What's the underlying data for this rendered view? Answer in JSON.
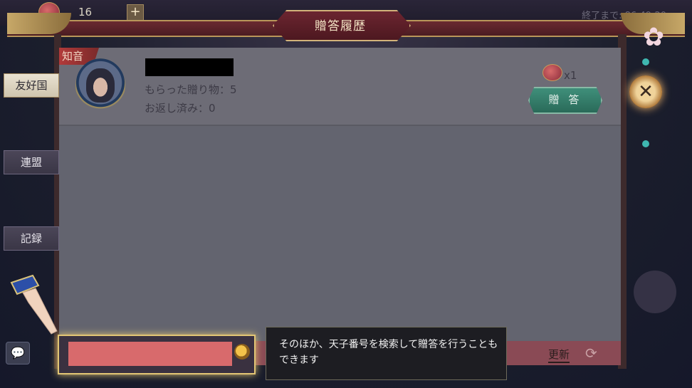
{
  "header": {
    "currency_value": "16",
    "plus_label": "+",
    "timer": "終了まで: 86:49:20",
    "title": "贈答履歴"
  },
  "tabs": [
    {
      "label": "友好国",
      "active": true
    },
    {
      "label": "連盟",
      "active": false
    },
    {
      "label": "記録",
      "active": false
    }
  ],
  "card": {
    "tag": "知音",
    "received": "もらった贈り物：5",
    "returned": "お返し済み：0",
    "gift_count": "x1",
    "gift_button": "贈 答"
  },
  "search": {
    "placeholder": ""
  },
  "bottom": {
    "refresh_label": "更新"
  },
  "tooltip": {
    "text": "そのほか、天子番号を検索して贈答を行うこともできます"
  },
  "colors": {
    "accent_gold": "#e2c574",
    "panel": "#63646f",
    "button_teal": "#3f8f7a"
  }
}
